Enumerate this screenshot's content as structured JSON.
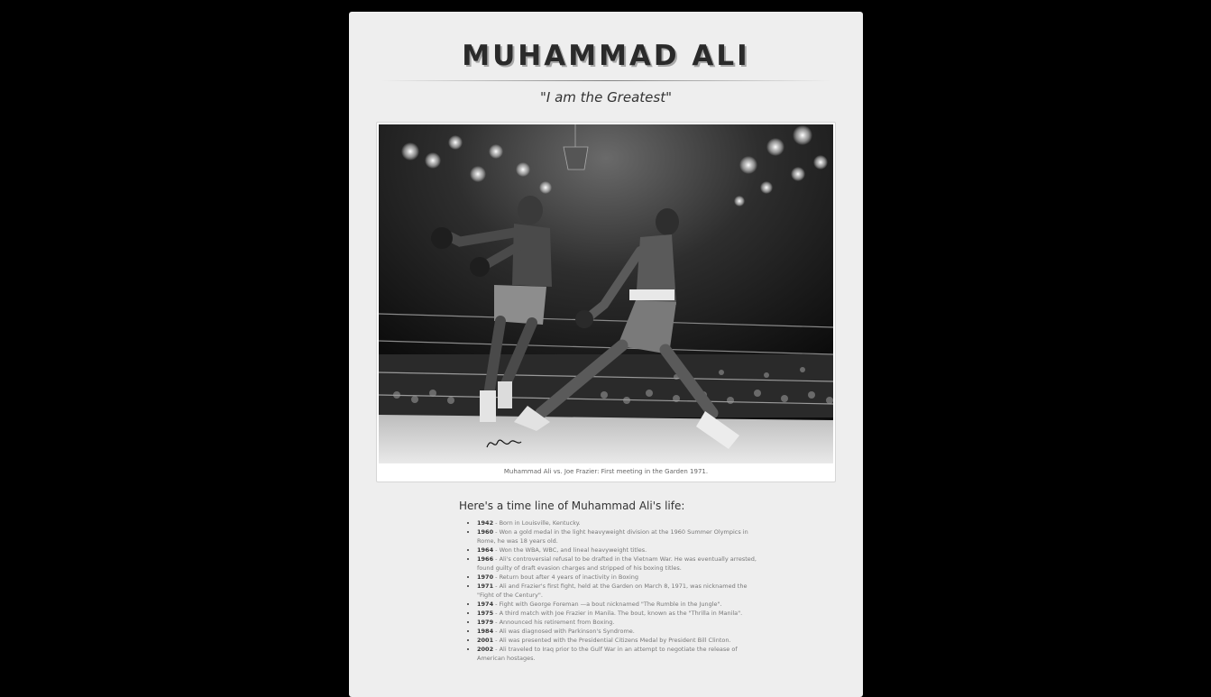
{
  "page": {
    "title": "MUHAMMAD ALI",
    "quote": "\"I am the Greatest\""
  },
  "figure": {
    "caption": "Muhammad Ali vs. Joe Frazier: First meeting in the Garden 1971."
  },
  "timeline": {
    "heading": "Here's a time line of Muhammad Ali's life:",
    "items": [
      {
        "year": "1942",
        "text": " - Born in Louisville, Kentucky."
      },
      {
        "year": "1960",
        "text": " - Won a gold medal in the light heavyweight division at the 1960 Summer Olympics in Rome, he was 18 years old."
      },
      {
        "year": "1964",
        "text": " - Won the WBA, WBC, and lineal heavyweight titles."
      },
      {
        "year": "1966",
        "text": " - Ali's controversial refusal to be drafted in the Vietnam War. He was eventually arrested, found guilty of draft evasion charges and stripped of his boxing titles."
      },
      {
        "year": "1970",
        "text": " - Return bout after 4 years of inactivity in Boxing"
      },
      {
        "year": "1971",
        "text": " - Ali and Frazier's first fight, held at the Garden on March 8, 1971, was nicknamed the \"Fight of the Century\"."
      },
      {
        "year": "1974",
        "text": " - Fight with George Foreman —a bout nicknamed \"The Rumble in the Jungle\"."
      },
      {
        "year": "1975",
        "text": " - A third match with Joe Frazier in Manila. The bout, known as the \"Thrilla in Manila\"."
      },
      {
        "year": "1979",
        "text": " - Announced his retirement from Boxing."
      },
      {
        "year": "1984",
        "text": " - Ali was diagnosed with Parkinson's Syndrome."
      },
      {
        "year": "2001",
        "text": " - Ali was presented with the Presidential Citizens Medal by President Bill Clinton."
      },
      {
        "year": "2002",
        "text": " - Ali traveled to Iraq prior to the Gulf War in an attempt to negotiate the release of American hostages."
      }
    ]
  }
}
